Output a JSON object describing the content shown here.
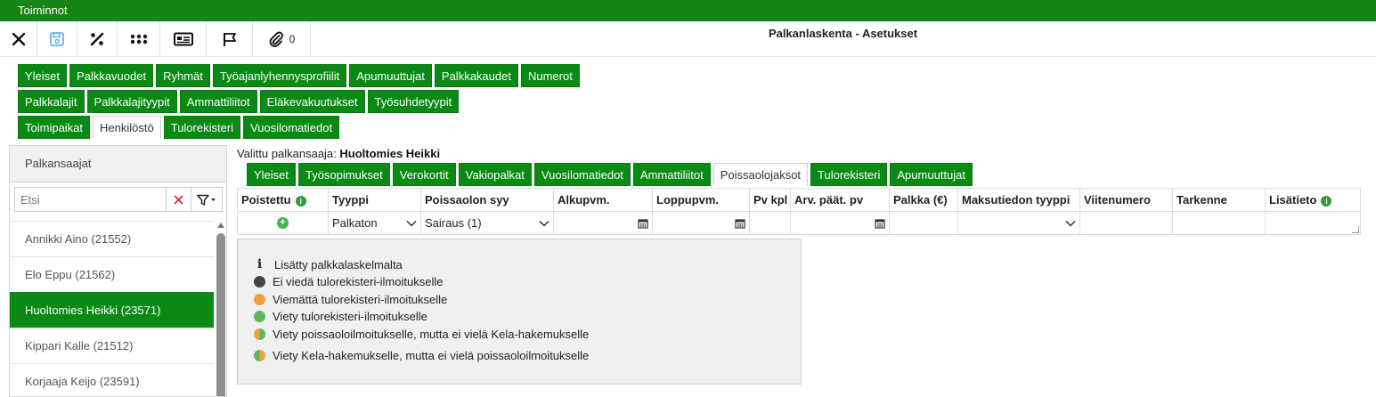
{
  "menubar": {
    "title": "Toiminnot"
  },
  "toolbar": {
    "attachment_count": "0"
  },
  "page": {
    "title": "Palkanlaskenta - Asetukset"
  },
  "settings_tabs": {
    "row1": [
      "Yleiset",
      "Palkkavuodet",
      "Ryhmät",
      "Työajanlyhennysprofiilit",
      "Apumuuttujat",
      "Palkkakaudet",
      "Numerot"
    ],
    "row2": [
      "Palkkalajit",
      "Palkkalajityypit",
      "Ammattiliitot",
      "Eläkevakuutukset",
      "Työsuhdetyypit"
    ],
    "row3": [
      "Toimipaikat",
      "Henkilöstö",
      "Tulorekisteri",
      "Vuosilomatiedot"
    ],
    "active": "Henkilöstö"
  },
  "left_panel": {
    "header": "Palkansaajat",
    "search_placeholder": "Etsi",
    "employees": [
      {
        "label": "Annikki Aino (21552)",
        "selected": false
      },
      {
        "label": "Elo Eppu (21562)",
        "selected": false
      },
      {
        "label": "Huoltomies Heikki (23571)",
        "selected": true
      },
      {
        "label": "Kippari Kalle (21512)",
        "selected": false
      },
      {
        "label": "Korjaaja Keijo (23591)",
        "selected": false
      }
    ]
  },
  "selected_employee": {
    "prefix": "Valittu palkansaaja: ",
    "name": "Huoltomies Heikki"
  },
  "employee_tabs": {
    "items": [
      "Yleiset",
      "Työsopimukset",
      "Verokortit",
      "Vakiopalkat",
      "Vuosilomatiedot",
      "Ammattiliitot",
      "Poissaolojaksot",
      "Tulorekisteri",
      "Apumuuttujat"
    ],
    "active": "Poissaolojaksot"
  },
  "absence_table": {
    "columns": [
      "Poistettu",
      "Tyyppi",
      "Poissaolon syy",
      "Alkupvm.",
      "Loppupvm.",
      "Pv kpl",
      "Arv. päät. pv",
      "Palkka (€)",
      "Maksutiedon tyyppi",
      "Viitenumero",
      "Tarkenne",
      "Lisätieto"
    ],
    "new_row": {
      "tyyppi": "Palkaton",
      "poissaolon_syy": "Sairaus (1)",
      "alkupvm": "",
      "loppupvm": "",
      "pv_kpl": "",
      "arv_paat_pv": "",
      "palkka": "",
      "maksutiedon_tyyppi": "",
      "viitenumero": "",
      "tarkenne": "",
      "lisatieto": ""
    }
  },
  "legend": {
    "items": [
      {
        "icon": "info-icon",
        "label": "Lisätty palkkalaskelmalta"
      },
      {
        "icon": "dark-dot",
        "color": "#444444",
        "label": "Ei viedä tulorekisteri-ilmoitukselle"
      },
      {
        "icon": "orange-dot",
        "color": "#f0a040",
        "label": "Viemättä tulorekisteri-ilmoitukselle"
      },
      {
        "icon": "green-dot",
        "color": "#5cb85c",
        "label": "Viety tulorekisteri-ilmoitukselle"
      },
      {
        "icon": "half-dot",
        "color": "#f0a040",
        "label": "Viety poissaoloilmoitukselle, mutta ei vielä Kela-hakemukselle"
      },
      {
        "icon": "half-dot",
        "color": "#5cb85c",
        "label": "Viety Kela-hakemukselle, mutta ei vielä poissaoloilmoitukselle"
      }
    ]
  }
}
